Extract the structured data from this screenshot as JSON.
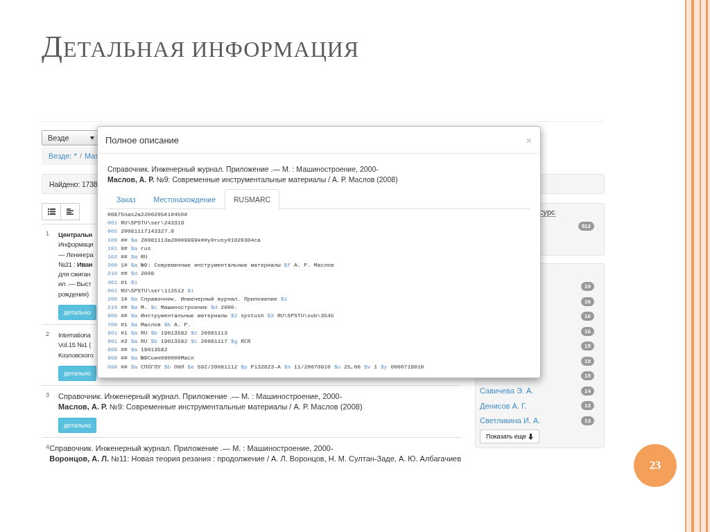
{
  "slide": {
    "title": "ДЕТАЛЬНАЯ ИНФОРМАЦИЯ",
    "number": "23"
  },
  "search": {
    "scope": "Везде"
  },
  "breadcrumb": {
    "items": [
      "Везде: *",
      "Мат"
    ],
    "separator": "/"
  },
  "found": "Найдено: 1738",
  "results": [
    {
      "number": "1",
      "kind": "partial",
      "lines": [
        "**Центральн**",
        "Информаци",
        "— Ленингра",
        "№21 : **Иван**",
        "для сжиган",
        "ил .— Выст",
        "рождения)"
      ],
      "button": "детально"
    },
    {
      "number": "2",
      "kind": "partial",
      "lines": [
        "Internationa",
        "Vol.15 №1 (",
        "Козловского"
      ],
      "button": "детально"
    },
    {
      "number": "3",
      "kind": "full",
      "lines": [
        "Справочник. Инженерный журнал. Приложение .— М. : Машиностроение, 2000-",
        "**Маслов, А. Р.** №9: Современные инструментальные материалы / А. Р. Маслов (2008)"
      ],
      "button": "детально"
    },
    {
      "number": "4",
      "kind": "full",
      "lines": [
        "Справочник. Инженерный журнал. Приложение .— М. : Машиностроение, 2000-",
        "**Воронцов, А. Л.** №11: Новая теория резания : продолжение / А. Л. Воронцов, Н. М. Султан-Заде, А. Ю. Албагачиев"
      ]
    }
  ],
  "facets": [
    {
      "title": "сурс",
      "items": [
        {
          "count": "512"
        }
      ]
    },
    {
      "items": [
        {
          "count": "19"
        },
        {
          "count": "16"
        },
        {
          "count": "16"
        },
        {
          "count": "16"
        },
        {
          "count": "15"
        },
        {
          "count": "15"
        },
        {
          "count": "15"
        },
        {
          "label": "Савичева Э. А.",
          "count": "14"
        },
        {
          "label": "Денисов А. Г.",
          "count": "13"
        },
        {
          "label": "Светликина И. А.",
          "count": "13"
        }
      ],
      "more_button": "Показать еще"
    }
  ],
  "modal": {
    "title": "Полное описание",
    "close": "×",
    "citation": [
      "Справочник. Инженерный журнал. Приложение .— М. : Машиностроение, 2000-",
      "**Маслов, А. Р.** №9: Современные инструментальные материалы / А. Р. Маслов (2008)"
    ],
    "tabs": [
      {
        "label": "Заказ",
        "selected": false
      },
      {
        "label": "Местонахождение",
        "selected": false
      },
      {
        "label": "RUSMARC",
        "selected": true
      }
    ],
    "marc": [
      {
        "parts": [
          {
            "kind": "text",
            "text": "00875nas2a2200205#i#450#"
          }
        ]
      },
      {
        "tag": "001",
        "parts": [
          {
            "kind": "text",
            "text": "RU\\SPSTU\\ser\\243316"
          }
        ]
      },
      {
        "tag": "005",
        "parts": [
          {
            "kind": "text",
            "text": "20081117143327.0"
          }
        ]
      },
      {
        "tag": "100",
        "ind": "##",
        "parts": [
          {
            "kind": "code",
            "text": "$a"
          },
          {
            "kind": "text",
            "text": "20081113a20009999k##y0rusy01020304ca"
          }
        ]
      },
      {
        "tag": "101",
        "ind": "0#",
        "parts": [
          {
            "kind": "code",
            "text": "$a"
          },
          {
            "kind": "text",
            "text": "rus"
          }
        ]
      },
      {
        "tag": "102",
        "ind": "##",
        "parts": [
          {
            "kind": "code",
            "text": "$a"
          },
          {
            "kind": "text",
            "text": "RU"
          }
        ]
      },
      {
        "tag": "200",
        "ind": "1#",
        "parts": [
          {
            "kind": "code",
            "text": "$a"
          },
          {
            "kind": "text",
            "text": "№9: Современные инструментальные материалы"
          },
          {
            "kind": "code",
            "text": "$f"
          },
          {
            "kind": "text",
            "text": "А. Р. Маслов"
          }
        ]
      },
      {
        "tag": "210",
        "ind": "##",
        "parts": [
          {
            "kind": "code",
            "text": "$d"
          },
          {
            "kind": "text",
            "text": "2008"
          }
        ]
      },
      {
        "tag": "461",
        "ind": "#1",
        "parts": [
          {
            "kind": "code",
            "text": "$1"
          }
        ]
      },
      {
        "tag": "001",
        "parts": [
          {
            "kind": "text",
            "text": "RU\\SPSTU\\ser\\112512"
          },
          {
            "kind": "code",
            "text": "$1"
          }
        ]
      },
      {
        "tag": "200",
        "ind": "1#",
        "parts": [
          {
            "kind": "code",
            "text": "$a"
          },
          {
            "kind": "text",
            "text": "Справочник. Инженерный журнал. Приложение"
          },
          {
            "kind": "code",
            "text": "$1"
          }
        ]
      },
      {
        "tag": "210",
        "ind": "##",
        "parts": [
          {
            "kind": "code",
            "text": "$a"
          },
          {
            "kind": "text",
            "text": "М."
          },
          {
            "kind": "code",
            "text": "$c"
          },
          {
            "kind": "text",
            "text": "Машиностроение"
          },
          {
            "kind": "code",
            "text": "$d"
          },
          {
            "kind": "text",
            "text": "2000-"
          }
        ]
      },
      {
        "tag": "606",
        "ind": "##",
        "parts": [
          {
            "kind": "code",
            "text": "$a"
          },
          {
            "kind": "text",
            "text": "Инструментальные материалы"
          },
          {
            "kind": "code",
            "text": "$2"
          },
          {
            "kind": "text",
            "text": "spstush"
          },
          {
            "kind": "code",
            "text": "$3"
          },
          {
            "kind": "text",
            "text": "RU\\SPSTU\\sub\\3545"
          }
        ]
      },
      {
        "tag": "700",
        "ind": "#1",
        "parts": [
          {
            "kind": "code",
            "text": "$a"
          },
          {
            "kind": "text",
            "text": "Маслов"
          },
          {
            "kind": "code",
            "text": "$b"
          },
          {
            "kind": "text",
            "text": "А. Р."
          }
        ]
      },
      {
        "tag": "801",
        "ind": "#1",
        "parts": [
          {
            "kind": "code",
            "text": "$a"
          },
          {
            "kind": "text",
            "text": "RU"
          },
          {
            "kind": "code",
            "text": "$b"
          },
          {
            "kind": "text",
            "text": "19013582"
          },
          {
            "kind": "code",
            "text": "$c"
          },
          {
            "kind": "text",
            "text": "20081113"
          }
        ]
      },
      {
        "tag": "801",
        "ind": "#2",
        "parts": [
          {
            "kind": "code",
            "text": "$a"
          },
          {
            "kind": "text",
            "text": "RU"
          },
          {
            "kind": "code",
            "text": "$b"
          },
          {
            "kind": "text",
            "text": "19013582"
          },
          {
            "kind": "code",
            "text": "$c"
          },
          {
            "kind": "text",
            "text": "20081117"
          },
          {
            "kind": "code",
            "text": "$g"
          },
          {
            "kind": "text",
            "text": "RCR"
          }
        ]
      },
      {
        "tag": "899",
        "ind": "##",
        "parts": [
          {
            "kind": "code",
            "text": "$a"
          },
          {
            "kind": "text",
            "text": "19013582"
          }
        ]
      },
      {
        "tag": "998",
        "ind": "##",
        "parts": [
          {
            "kind": "code",
            "text": "$a"
          },
          {
            "kind": "text",
            "text": "№9Соин080000Масл"
          }
        ]
      },
      {
        "tag": "999",
        "ind": "##",
        "parts": [
          {
            "kind": "code",
            "text": "$a"
          },
          {
            "kind": "text",
            "text": "СПбГПУ"
          },
          {
            "kind": "code",
            "text": "$b"
          },
          {
            "kind": "text",
            "text": "ОНЛ"
          },
          {
            "kind": "code",
            "text": "$e"
          },
          {
            "kind": "text",
            "text": "592/20081112"
          },
          {
            "kind": "code",
            "text": "$p"
          },
          {
            "kind": "text",
            "text": "Р132623-А"
          },
          {
            "kind": "code",
            "text": "$s"
          },
          {
            "kind": "text",
            "text": "11/20070910"
          },
          {
            "kind": "code",
            "text": "$u"
          },
          {
            "kind": "text",
            "text": "25,00"
          },
          {
            "kind": "code",
            "text": "$v"
          },
          {
            "kind": "text",
            "text": "1"
          },
          {
            "kind": "code",
            "text": "$y"
          },
          {
            "kind": "text",
            "text": "0000718010"
          }
        ]
      }
    ]
  }
}
